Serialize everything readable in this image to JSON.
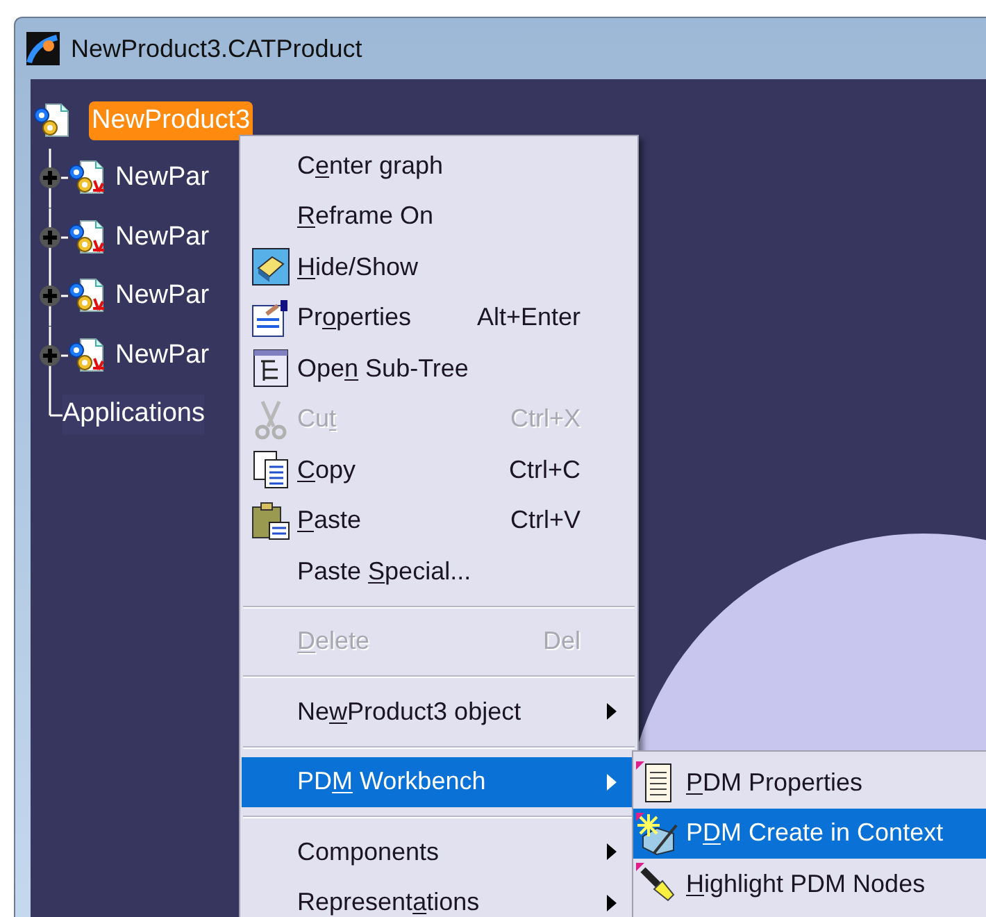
{
  "window": {
    "title": "NewProduct3.CATProduct"
  },
  "tree": {
    "root": {
      "label": "NewProduct3",
      "selected": true
    },
    "children": [
      {
        "kind": "part",
        "label": "NewPar",
        "expanded": false
      },
      {
        "kind": "part",
        "label": "NewPar",
        "expanded": false
      },
      {
        "kind": "part",
        "label": "NewPar",
        "expanded": false
      },
      {
        "kind": "part",
        "label": "NewPar",
        "expanded": false
      },
      {
        "kind": "leaf",
        "label": "Applications"
      }
    ]
  },
  "context_menu": {
    "items": [
      {
        "kind": "command",
        "pre": "C",
        "key": "e",
        "post": "nter graph",
        "disabled": false,
        "selected": false
      },
      {
        "kind": "command",
        "key": "R",
        "post": "eframe On",
        "disabled": false,
        "selected": false
      },
      {
        "kind": "command",
        "key": "H",
        "post": "ide/Show",
        "disabled": false,
        "selected": false
      },
      {
        "kind": "command",
        "pre": "Pr",
        "key": "o",
        "post": "perties",
        "shortcut": "Alt+Enter",
        "disabled": false,
        "selected": false
      },
      {
        "kind": "command",
        "pre": "Ope",
        "key": "n",
        "post": " Sub-Tree",
        "disabled": false,
        "selected": false
      },
      {
        "kind": "command",
        "pre": "Cu",
        "key": "t",
        "shortcut": "Ctrl+X",
        "disabled": true,
        "selected": false
      },
      {
        "kind": "command",
        "key": "C",
        "post": "opy",
        "shortcut": "Ctrl+C",
        "disabled": false,
        "selected": false
      },
      {
        "kind": "command",
        "key": "P",
        "post": "aste",
        "shortcut": "Ctrl+V",
        "disabled": false,
        "selected": false
      },
      {
        "kind": "command",
        "pre": "Paste ",
        "key": "S",
        "post": "pecial...",
        "disabled": false,
        "selected": false
      },
      {
        "kind": "separator"
      },
      {
        "kind": "command",
        "key": "D",
        "post": "elete",
        "shortcut": "Del",
        "disabled": true,
        "selected": false
      },
      {
        "kind": "separator"
      },
      {
        "kind": "submenu",
        "pre": "Ne",
        "key": "w",
        "post": "Product3 object",
        "disabled": false,
        "selected": false
      },
      {
        "kind": "separator"
      },
      {
        "kind": "submenu",
        "pre": "PD",
        "key": "M",
        "post": " Workbench",
        "disabled": false,
        "selected": true
      },
      {
        "kind": "separator"
      },
      {
        "kind": "submenu",
        "pre": "Components",
        "disabled": false,
        "selected": false
      },
      {
        "kind": "submenu",
        "pre": "Represent",
        "key": "a",
        "post": "tions",
        "disabled": false,
        "selected": false
      }
    ]
  },
  "submenu": {
    "items": [
      {
        "key": "P",
        "post": "DM Properties",
        "selected": false
      },
      {
        "pre": "P",
        "key": "D",
        "post": "M Create in Context",
        "selected": true
      },
      {
        "key": "H",
        "post": "ighlight PDM Nodes",
        "selected": false
      }
    ]
  }
}
